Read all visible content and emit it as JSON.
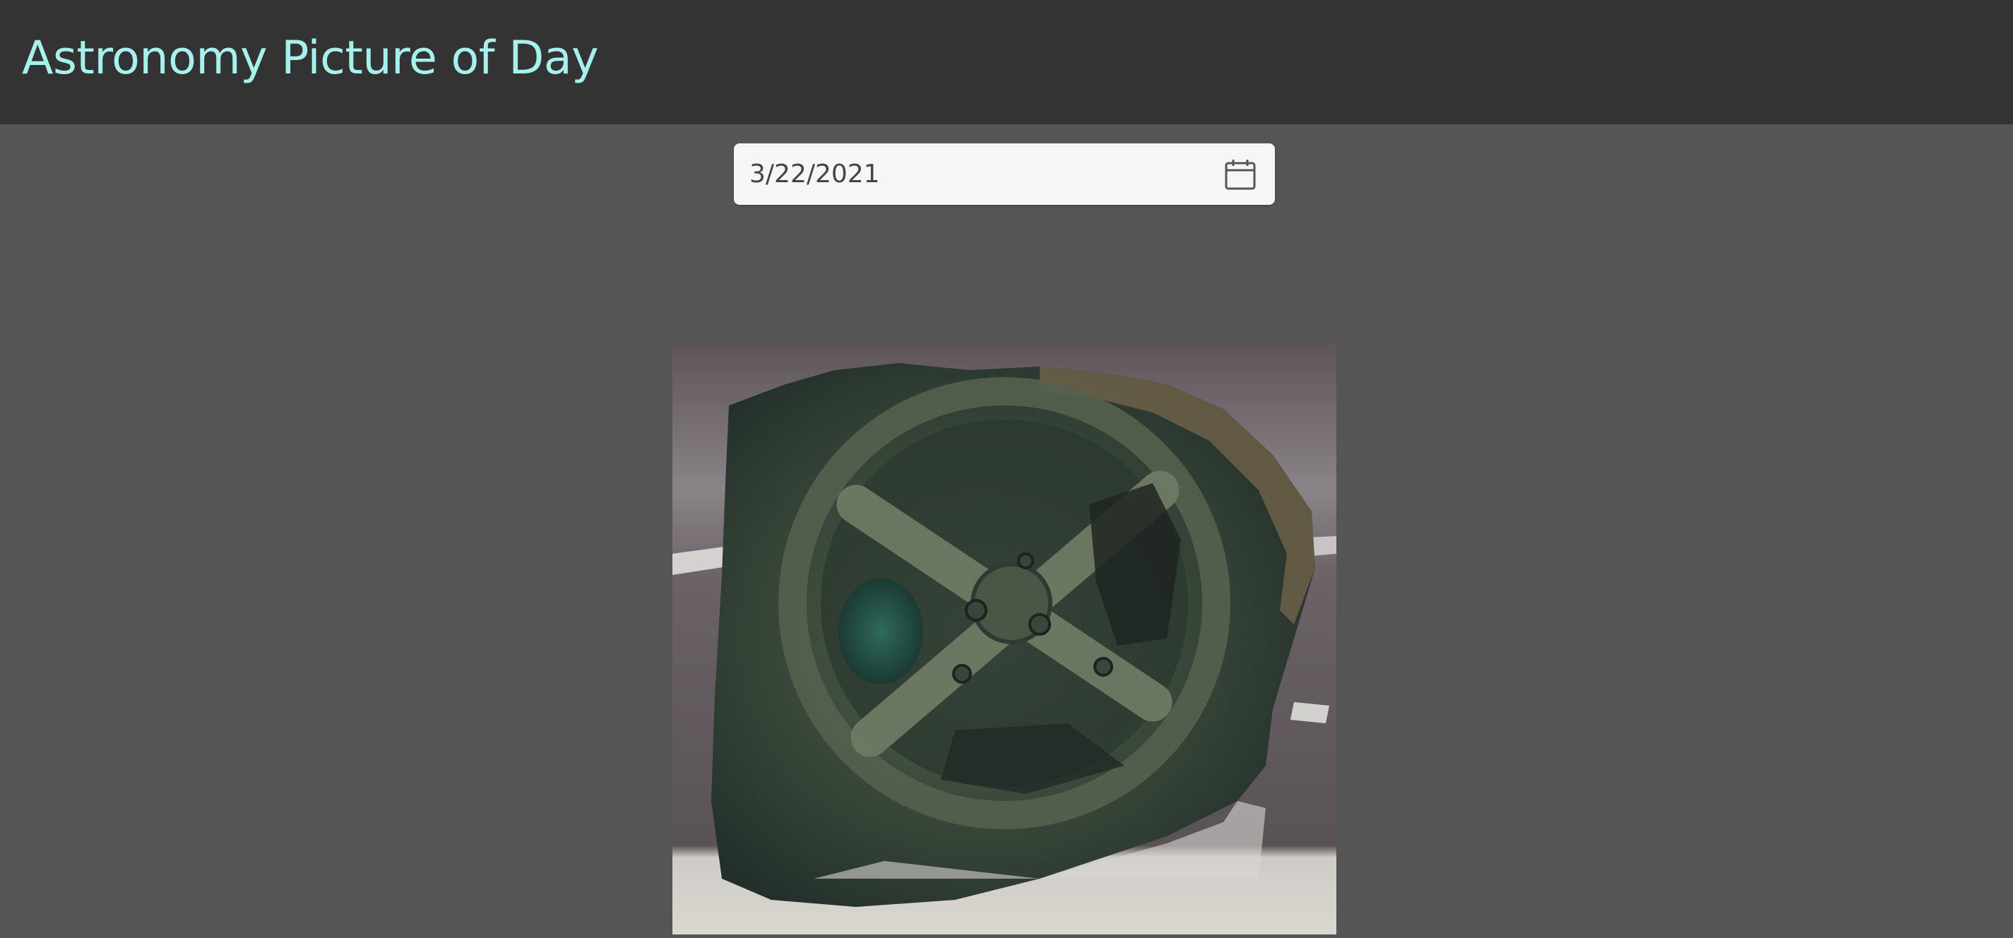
{
  "header": {
    "title": "Astronomy Picture of Day"
  },
  "date_picker": {
    "value": "3/22/2021",
    "icon": "calendar-icon"
  },
  "colors": {
    "header_bg": "#333333",
    "page_bg": "#555555",
    "title_color": "#a6f1ee",
    "input_bg": "#f6f6f6"
  }
}
